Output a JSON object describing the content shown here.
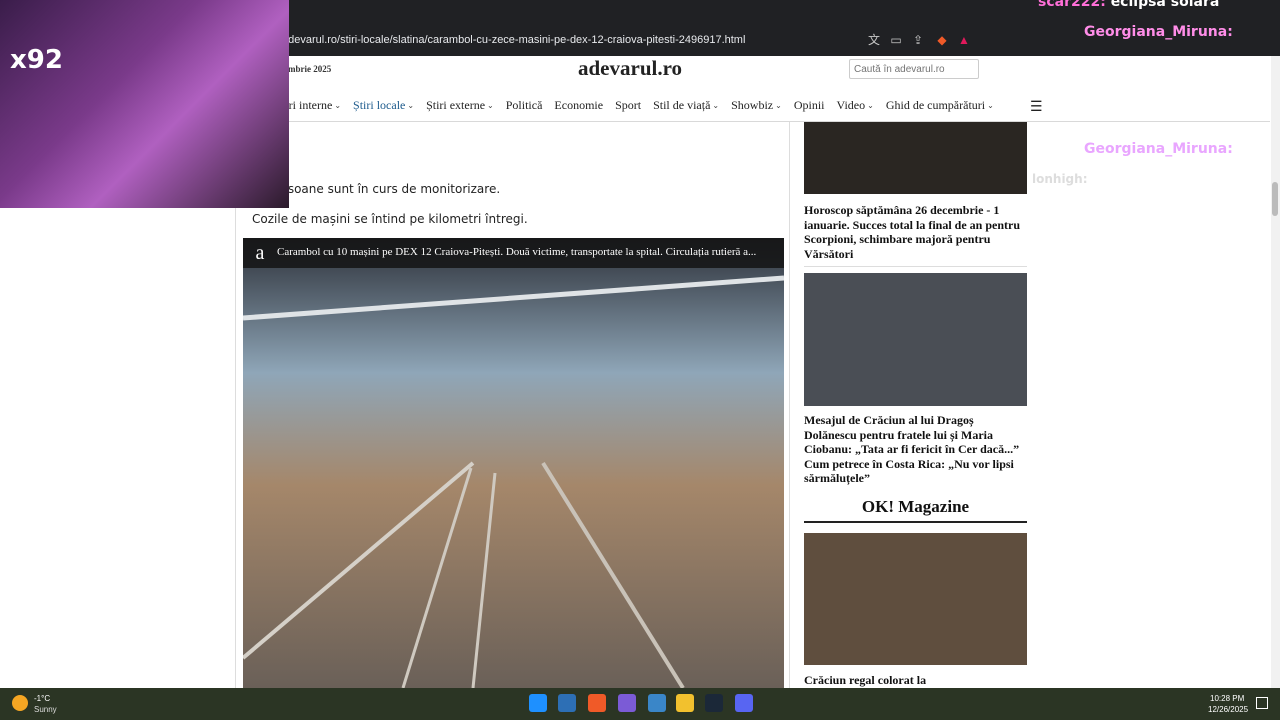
{
  "browser": {
    "url": "adevarul.ro/stiri-locale/slatina/carambol-cu-zece-masini-pe-dex-12-craiova-pitesti-2496917.html"
  },
  "header": {
    "date": "mbrie 2025",
    "logo": "adevarul.ro",
    "search_placeholder": "Caută în adevarul.ro",
    "nav": [
      "tiri interne",
      "Știri locale",
      "Știri externe",
      "Politică",
      "Economie",
      "Sport",
      "Stil de viață",
      "Showbiz",
      "Opinii",
      "Video",
      "Ghid de cumpărături"
    ]
  },
  "article": {
    "para1": "te persoane sunt în curs de monitorizare.",
    "para2": "Cozile de mașini se întind pe kilometri întregi.",
    "video_title": "Carambol cu 10 mașini pe DEX 12 Craiova-Pitești. Două victime, transportate la spital. Circulația rutieră a..."
  },
  "sidebar": {
    "story1": "Horoscop săptămâna 26 decembrie - 1 ianuarie. Succes total la final de an pentru Scorpioni, schimbare majoră pentru Vărsători",
    "story2": "Mesajul de Crăciun al lui Dragoș Dolănescu pentru fratele lui și Maria Ciobanu: „Tata ar fi fericit în Cer dacă...” Cum petrece în Costa Rica: „Nu vor lipsi sărmăluțele”",
    "section": "OK! Magazine",
    "story3": "Crăciun regal colorat la"
  },
  "overlay": {
    "webcam_badge": "x92",
    "chat": [
      {
        "user": "scar222:",
        "msg": "eclipsa solara",
        "color": "#ff6fd8"
      },
      {
        "user": "Georgiana_Miruna:",
        "msg": "",
        "color": "#ff8de8"
      },
      {
        "user": "Georgiana_Miruna:",
        "msg": "",
        "color": "#e9a6ff"
      },
      {
        "user": "lonhigh:",
        "msg": "",
        "color": "#dddddd"
      }
    ]
  },
  "taskbar": {
    "temp": "-1°C",
    "condition": "Sunny",
    "time": "10:28 PM",
    "date": "12/26/2025"
  }
}
